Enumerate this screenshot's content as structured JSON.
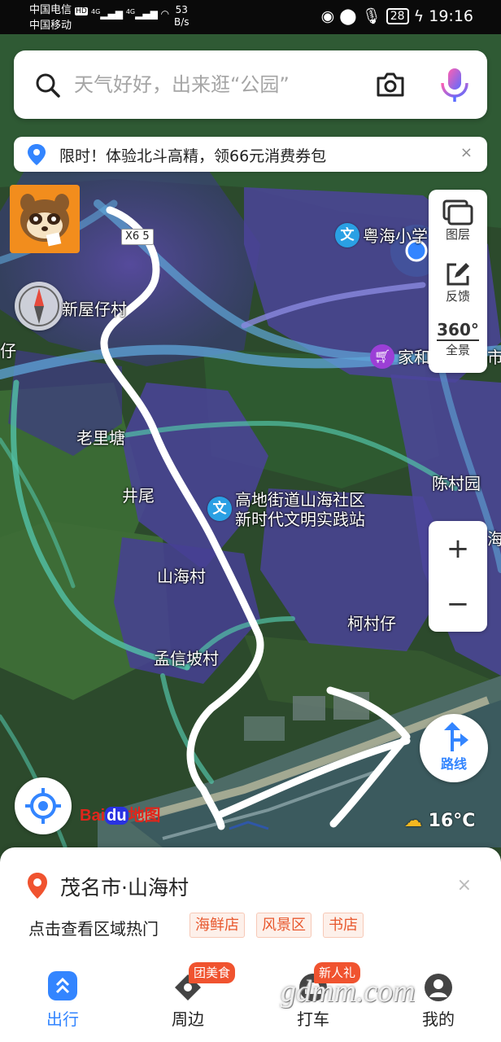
{
  "status_bar": {
    "carrier1": "中国电信",
    "hd": "HD",
    "carrier2": "中国移动",
    "net": "4G",
    "speed_num": "53",
    "speed_unit": "B/s",
    "battery": "28",
    "time": "19:16"
  },
  "search": {
    "placeholder": "天气好好，出来逛“公园”"
  },
  "banner": {
    "text": "限时！体验北斗高精，领66元消费券包",
    "close": "×"
  },
  "tools": {
    "layers": "图层",
    "feedback": "反馈",
    "panorama_badge": "360°",
    "panorama": "全景"
  },
  "zoom": {
    "in": "+",
    "out": "−"
  },
  "route_button": "路线",
  "map_labels": {
    "road_tag": "X6",
    "road_tag_tail": "5",
    "school": "粤海小学",
    "xinwuzai": "新屋仔村",
    "zai": "仔",
    "jiahe": "家和",
    "shi": "市",
    "laolitang": "老里塘",
    "jingwei": "井尾",
    "station_line1": "高地街道山海社区",
    "station_line2": "新时代文明实践站",
    "chencunyuan": "陈村园",
    "hai": "海",
    "shanhaicun": "山海村",
    "kecunzai": "柯村仔",
    "mengxinpocun": "孟信坡村"
  },
  "poi_glyph": "文",
  "logo": {
    "bai": "Bai",
    "du": "du",
    "map": "地图"
  },
  "weather": {
    "temp": "16°C"
  },
  "place": {
    "title": "茂名市·山海村",
    "close": "×",
    "hot_label": "点击查看区域热门",
    "tags": [
      "海鲜店",
      "风景区",
      "书店"
    ]
  },
  "tabs": [
    {
      "label": "出行",
      "badge": ""
    },
    {
      "label": "周边",
      "badge": "团美食"
    },
    {
      "label": "打车",
      "badge": "新人礼"
    },
    {
      "label": "我的",
      "badge": ""
    }
  ],
  "watermark": "gdmm.com",
  "colors": {
    "accent": "#3385ff",
    "badge": "#f0532f",
    "tag_text": "#e8582e",
    "road": "#7fb3d9",
    "poi": "#2aa0e4",
    "drawn_route": "#ffffff"
  },
  "icons": {
    "search": "search-icon",
    "camera": "camera-icon",
    "mic": "microphone-icon",
    "location_pin": "location-pin-icon",
    "layers": "layers-icon",
    "feedback": "feedback-icon",
    "route": "route-arrow-icon",
    "locate": "locate-icon",
    "weather": "partly-cloudy-icon"
  }
}
